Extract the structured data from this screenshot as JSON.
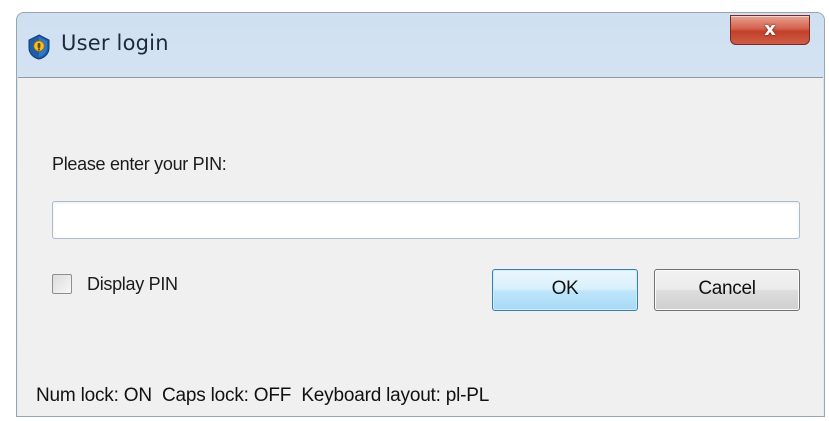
{
  "window": {
    "title": "User login",
    "icon": "lock-icon",
    "close_label": "x"
  },
  "form": {
    "prompt": "Please enter your PIN:",
    "pin_value": "",
    "display_pin_label": "Display PIN",
    "display_pin_checked": false
  },
  "buttons": {
    "ok_label": "OK",
    "cancel_label": "Cancel"
  },
  "status": {
    "text": "Num lock: ON  Caps lock: OFF  Keyboard layout: pl-PL"
  },
  "colors": {
    "close_button": "#c7442f",
    "ok_border": "#3c7fb1",
    "titlebar": "#d6e4f3"
  }
}
